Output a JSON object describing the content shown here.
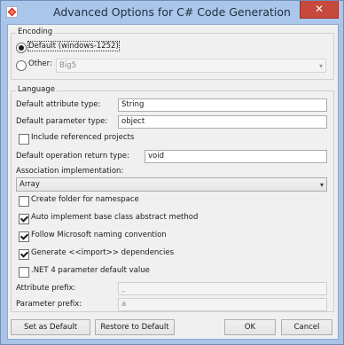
{
  "window": {
    "title": "Advanced Options for C# Code Generation",
    "close_glyph": "✕",
    "app_icon": "vp-diamond-icon"
  },
  "encoding": {
    "legend": "Encoding",
    "default_label": "Default (windows-1252)",
    "default_checked": true,
    "other_label": "Other:",
    "other_checked": false,
    "other_value": "Big5"
  },
  "language": {
    "legend": "Language",
    "default_attribute_type_label": "Default attribute type:",
    "default_attribute_type_value": "String",
    "default_parameter_type_label": "Default parameter type:",
    "default_parameter_type_value": "object",
    "include_referenced_projects_label": "Include referenced projects",
    "include_referenced_projects_checked": false,
    "default_return_type_label": "Default operation return type:",
    "default_return_type_value": "void",
    "association_label": "Association implementation:",
    "association_value": "Array",
    "create_folder_label": "Create folder for namespace",
    "create_folder_checked": false,
    "auto_implement_label": "Auto implement base class abstract method",
    "auto_implement_checked": true,
    "follow_naming_label": "Follow Microsoft naming convention",
    "follow_naming_checked": true,
    "generate_import_label": "Generate <<import>> dependencies",
    "generate_import_checked": true,
    "net4_label": ".NET 4 parameter default value",
    "net4_checked": false,
    "attribute_prefix_label": "Attribute prefix:",
    "attribute_prefix_value": "_",
    "parameter_prefix_label": "Parameter prefix:",
    "parameter_prefix_value": "a"
  },
  "buttons": {
    "set_default": "Set as Default",
    "restore_default": "Restore to Default",
    "ok": "OK",
    "cancel": "Cancel"
  }
}
